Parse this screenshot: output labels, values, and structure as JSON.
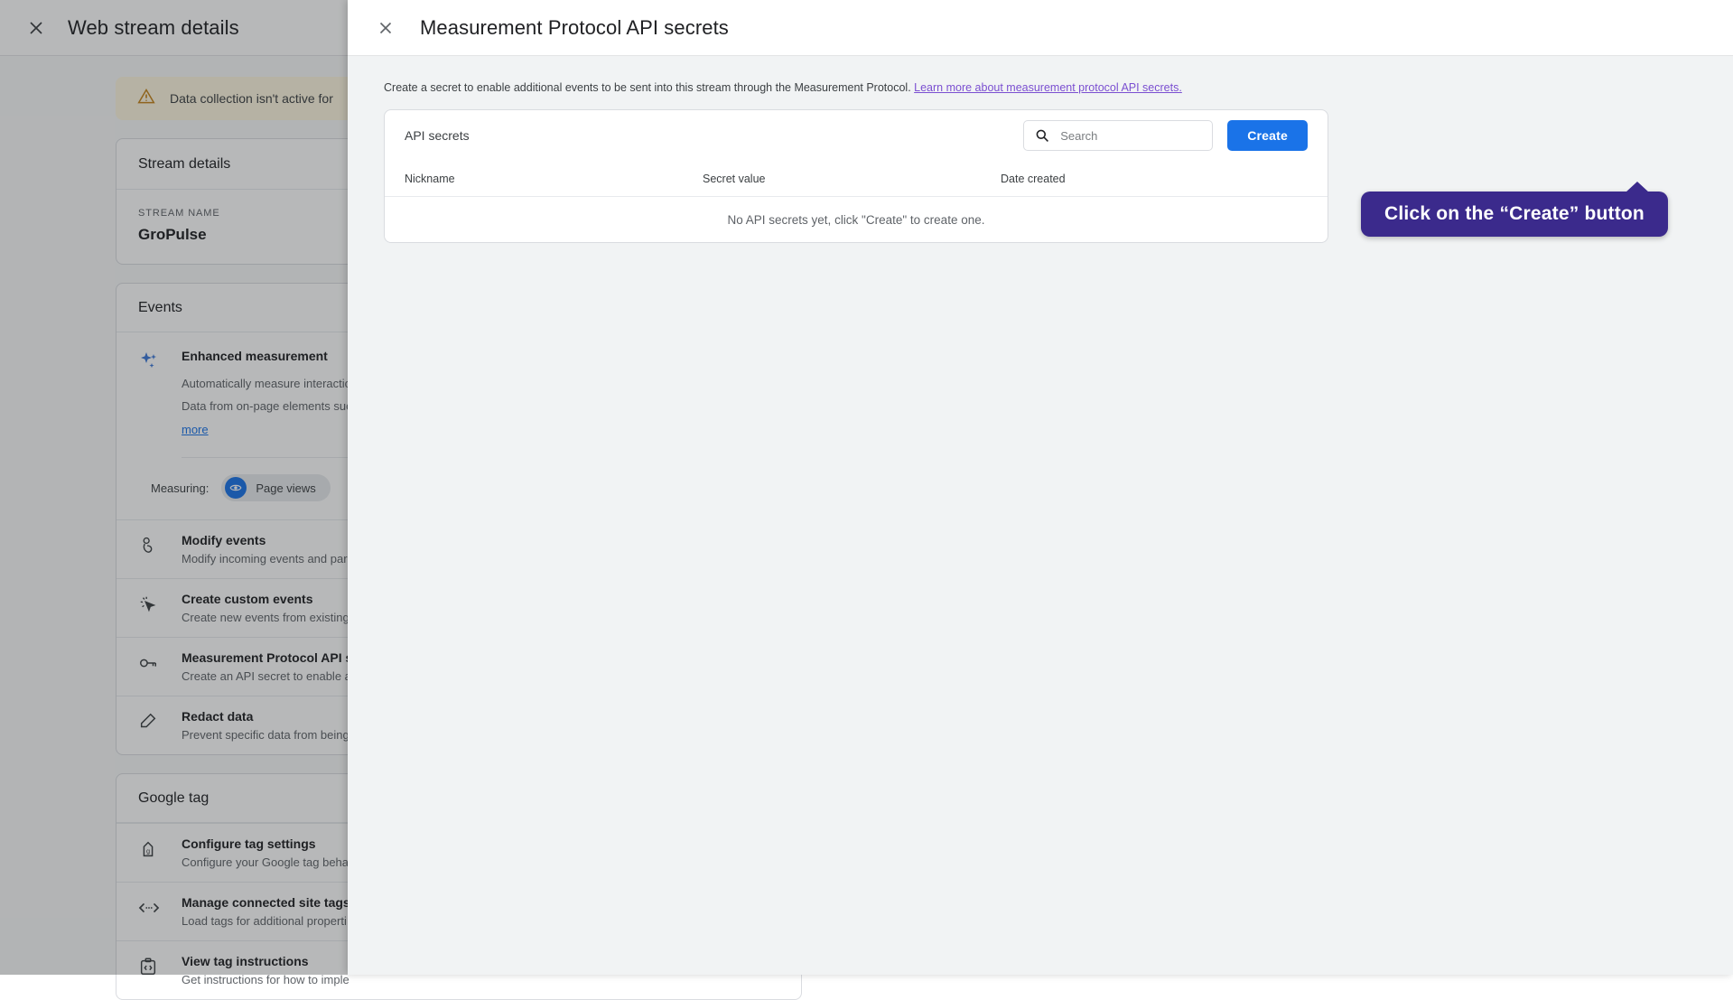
{
  "background": {
    "close_icon": "close-icon",
    "title": "Web stream details",
    "warning": {
      "icon": "warning-triangle-icon",
      "text": "Data collection isn't active for"
    },
    "stream_details": {
      "header": "Stream details",
      "stream_name_label": "STREAM NAME",
      "stream_name_value": "GroPulse"
    },
    "events": {
      "header": "Events",
      "enhanced": {
        "icon": "sparkle-icon",
        "title": "Enhanced measurement",
        "desc_line_1": "Automatically measure interactio",
        "desc_line_2": "Data from on-page elements suc",
        "more_label": "more",
        "measuring_label": "Measuring:",
        "chip_icon": "eye-icon",
        "chip_label": "Page views"
      },
      "items": [
        {
          "icon": "tap-finger-icon",
          "title": "Modify events",
          "subtitle": "Modify incoming events and para"
        },
        {
          "icon": "cursor-click-icon",
          "title": "Create custom events",
          "subtitle": "Create new events from existing"
        },
        {
          "icon": "key-icon",
          "title": "Measurement Protocol API s",
          "subtitle": "Create an API secret to enable a"
        },
        {
          "icon": "eraser-icon",
          "title": "Redact data",
          "subtitle": "Prevent specific data from being"
        }
      ]
    },
    "google_tag": {
      "header": "Google tag",
      "items": [
        {
          "icon": "tag-settings-icon",
          "title": "Configure tag settings",
          "subtitle": "Configure your Google tag behav"
        },
        {
          "icon": "code-arrows-icon",
          "title": "Manage connected site tags",
          "subtitle": "Load tags for additional properti"
        },
        {
          "icon": "clipboard-code-icon",
          "title": "View tag instructions",
          "subtitle": "Get instructions for how to imple"
        }
      ]
    }
  },
  "modal": {
    "close_icon": "close-icon",
    "title": "Measurement Protocol API secrets",
    "description_text": "Create a secret to enable additional events to be sent into this stream through the Measurement Protocol. ",
    "description_link": "Learn more about measurement protocol API secrets.",
    "panel": {
      "title": "API secrets",
      "search_icon": "search-icon",
      "search_value": "",
      "search_placeholder": "Search",
      "create_label": "Create",
      "columns": {
        "nickname": "Nickname",
        "secret_value": "Secret value",
        "date_created": "Date created"
      },
      "rows": [],
      "empty_message": "No API secrets yet, click \"Create\" to create one."
    }
  },
  "tooltip": {
    "text": "Click on the “Create” button"
  },
  "colors": {
    "accent_blue": "#1a73e8",
    "tooltip_purple": "#3b2a8c",
    "link_purple": "#7b4fd1",
    "warning_bg": "#fef7e0",
    "modal_bg": "#f1f3f4"
  }
}
